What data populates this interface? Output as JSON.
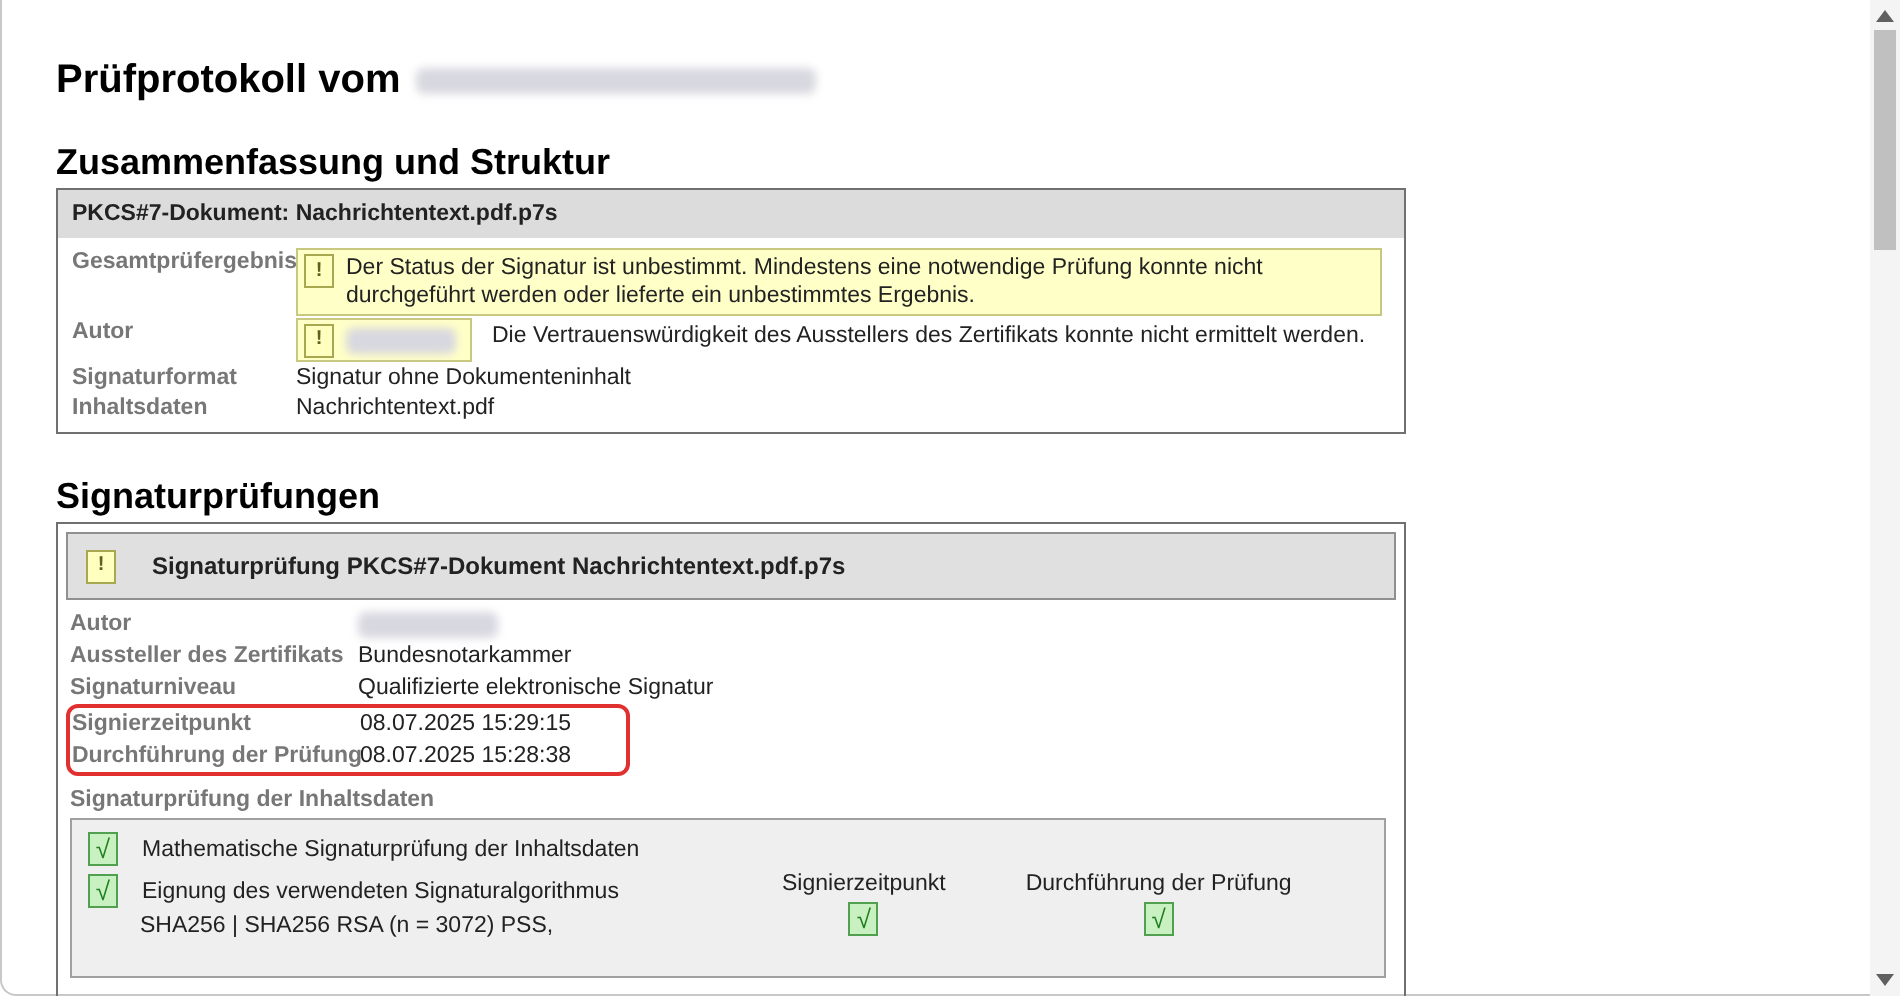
{
  "title": {
    "text": "Prüfprotokoll vom",
    "redacted": true
  },
  "summary": {
    "heading": "Zusammenfassung und Struktur",
    "box_title": "PKCS#7-Dokument: Nachrichtentext.pdf.p7s",
    "rows": [
      {
        "label": "Gesamtprüfergebnis",
        "kind": "alert",
        "icon": {
          "kind": "warning",
          "glyph": "!"
        },
        "text": "Der Status der Signatur ist unbestimmt. Mindestens eine notwendige Prüfung konnte nicht durchgeführt werden oder lieferte ein unbestimmtes Ergebnis."
      },
      {
        "label": "Autor",
        "kind": "redacted_alert",
        "icon": {
          "kind": "warning",
          "glyph": "!"
        },
        "note": "Die Vertrauenswürdigkeit des Ausstellers des Zertifikats konnte nicht ermittelt werden."
      },
      {
        "label": "Signaturformat",
        "kind": "plain",
        "value": "Signatur ohne Dokumenteninhalt"
      },
      {
        "label": "Inhaltsdaten",
        "kind": "plain",
        "value": "Nachrichtentext.pdf"
      }
    ]
  },
  "checks": {
    "heading": "Signaturprüfungen",
    "box_title": "Signaturprüfung PKCS#7-Dokument Nachrichtentext.pdf.p7s",
    "icon": {
      "kind": "warning",
      "glyph": "!"
    },
    "rows": [
      {
        "label": "Autor",
        "kind": "redacted",
        "highlighted": false
      },
      {
        "label": "Aussteller des Zertifikats",
        "kind": "plain",
        "value": "Bundesnotarkammer",
        "highlighted": false
      },
      {
        "label": "Signaturniveau",
        "kind": "plain",
        "value": "Qualifizierte elektronische Signatur",
        "highlighted": false
      },
      {
        "label": "Signierzeitpunkt",
        "kind": "plain",
        "value": "08.07.2025 15:29:15",
        "highlighted": true
      },
      {
        "label": "Durchführung der Prüfung",
        "kind": "plain",
        "value": "08.07.2025 15:28:38",
        "highlighted": true
      }
    ],
    "content_heading": "Signaturprüfung der Inhaltsdaten",
    "content_checks": [
      {
        "icon": {
          "kind": "ok",
          "glyph": "√"
        },
        "text": "Mathematische Signaturprüfung der Inhaltsdaten"
      },
      {
        "icon": {
          "kind": "ok",
          "glyph": "√"
        },
        "text": "Eignung des verwendeten Signaturalgorithmus"
      }
    ],
    "algorithm": "SHA256 | SHA256 RSA (n = 3072) PSS,",
    "columns": [
      {
        "label": "Signierzeitpunkt",
        "icon": {
          "kind": "ok",
          "glyph": "√"
        }
      },
      {
        "label": "Durchführung der Prüfung",
        "icon": {
          "kind": "ok",
          "glyph": "√"
        }
      }
    ]
  }
}
